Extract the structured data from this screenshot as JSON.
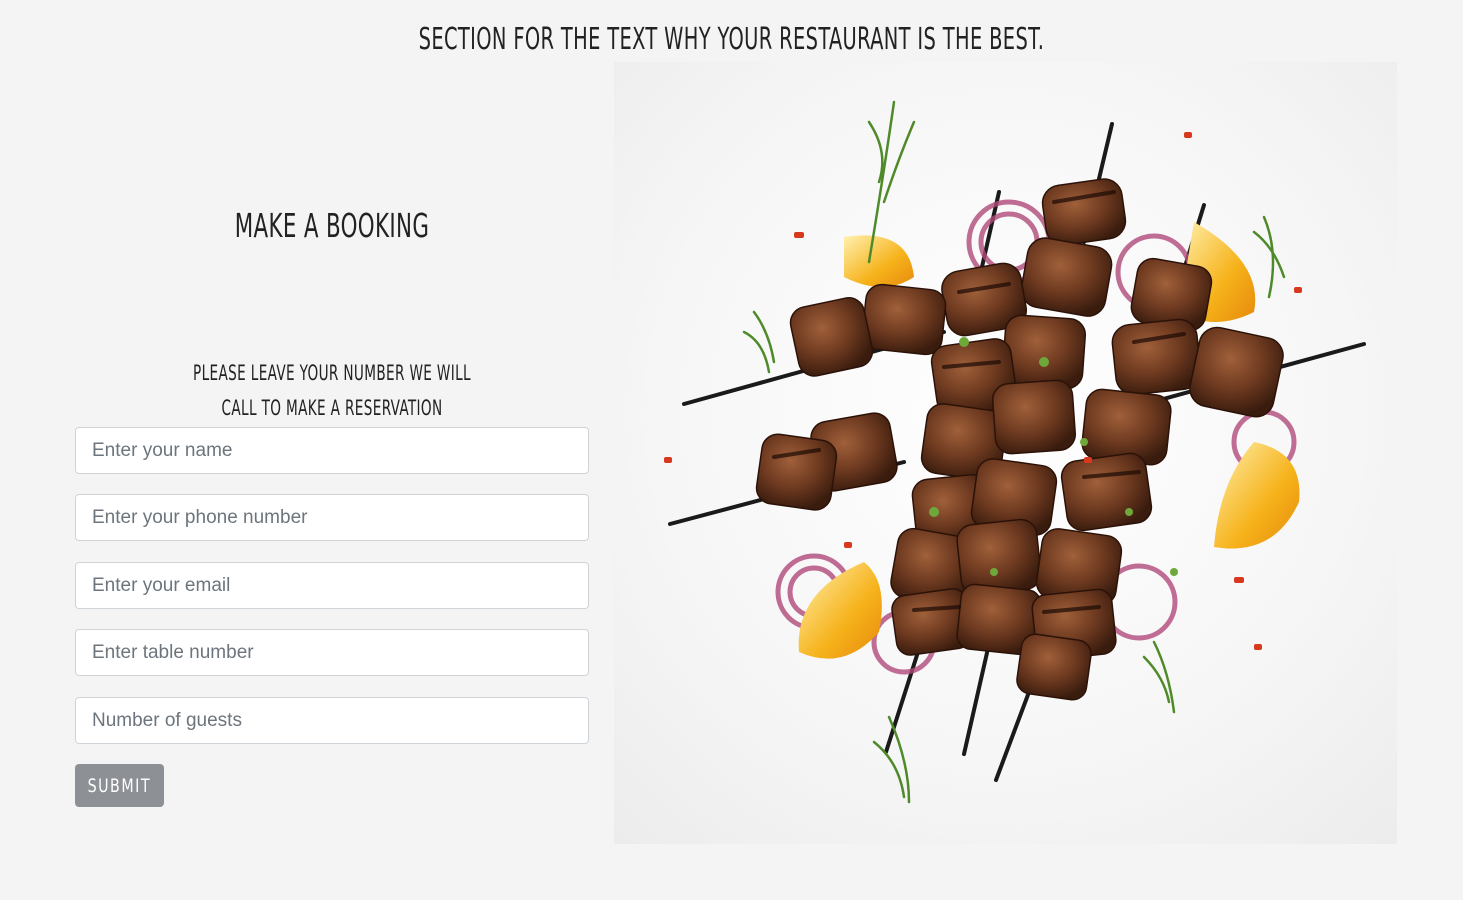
{
  "page": {
    "section_title": "SECTION FOR THE TEXT WHY YOUR RESTAURANT IS THE BEST.",
    "image_icon": "kebab-skewers-photo"
  },
  "booking": {
    "title": "MAKE A BOOKING",
    "subtitle_line1": "PLEASE LEAVE YOUR NUMBER WE WILL",
    "subtitle_line2": "CALL TO MAKE A RESERVATION",
    "fields": [
      {
        "placeholder": "Enter your name",
        "value": ""
      },
      {
        "placeholder": "Enter your phone number",
        "value": ""
      },
      {
        "placeholder": "Enter your email",
        "value": ""
      },
      {
        "placeholder": "Enter table number",
        "value": ""
      },
      {
        "placeholder": "Number of guests",
        "value": ""
      }
    ],
    "submit_label": "SUBMIT"
  },
  "colors": {
    "background": "#f4f4f4",
    "submit_button": "#8d9095",
    "text": "#222222"
  }
}
